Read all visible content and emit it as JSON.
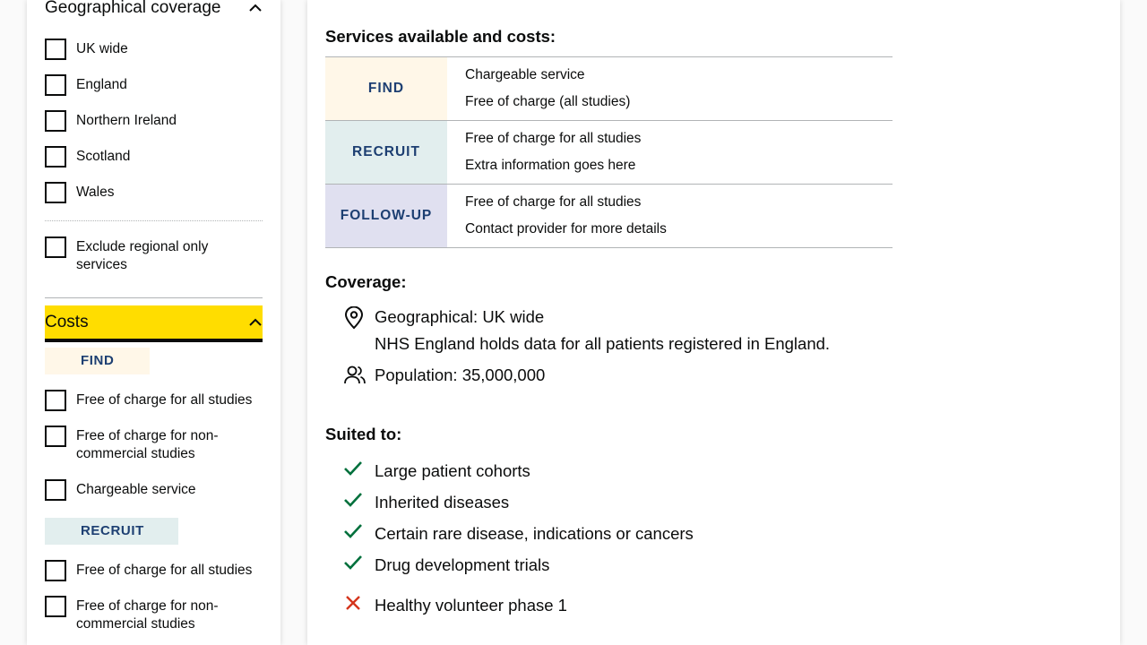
{
  "filters": {
    "geo_title": "Geographical coverage",
    "geo_options": [
      "UK wide",
      "England",
      "Northern Ireland",
      "Scotland",
      "Wales"
    ],
    "exclude_regional": "Exclude regional only services",
    "costs_title": "Costs",
    "find_tag": "FIND",
    "find_options": [
      "Free of charge for all studies",
      "Free of charge for non-commercial studies",
      "Chargeable service"
    ],
    "recruit_tag": "RECRUIT",
    "recruit_options": [
      "Free of charge for all studies",
      "Free of charge for non-commercial studies"
    ]
  },
  "detail": {
    "services_heading": "Services available and costs:",
    "services": [
      {
        "tag": "FIND",
        "line1": "Chargeable service",
        "line2": "Free of charge (all studies)",
        "bg": "#fff7e8"
      },
      {
        "tag": "RECRUIT",
        "line1": "Free of charge for all studies",
        "line2": "Extra information goes here",
        "bg": "#e2eeee"
      },
      {
        "tag": "FOLLOW-UP",
        "line1": "Free of charge for all studies",
        "line2": "Contact provider for more details",
        "bg": "#e0e0f0"
      }
    ],
    "coverage_heading": "Coverage:",
    "geo_line": "Geographical: UK wide",
    "geo_note": "NHS England holds data for all patients registered in England.",
    "population": "Population: 35,000,000",
    "suited_heading": "Suited to:",
    "suited_yes": [
      "Large patient cohorts",
      "Inherited diseases",
      "Certain rare disease, indications or cancers",
      "Drug development trials"
    ],
    "suited_no": [
      "Healthy volunteer phase 1"
    ]
  },
  "colors": {
    "accent_yellow": "#ffdd00",
    "tag_text": "#1d3f72",
    "check_green": "#00703c",
    "cross_red": "#d4351c",
    "find_bg": "#fff7e8",
    "recruit_bg": "#e2eeee",
    "followup_bg": "#e0e0f0"
  },
  "icons": {
    "collapse": "chevron-up-icon",
    "location": "map-pin-icon",
    "population": "users-icon",
    "yes": "check-icon",
    "no": "cross-icon"
  }
}
